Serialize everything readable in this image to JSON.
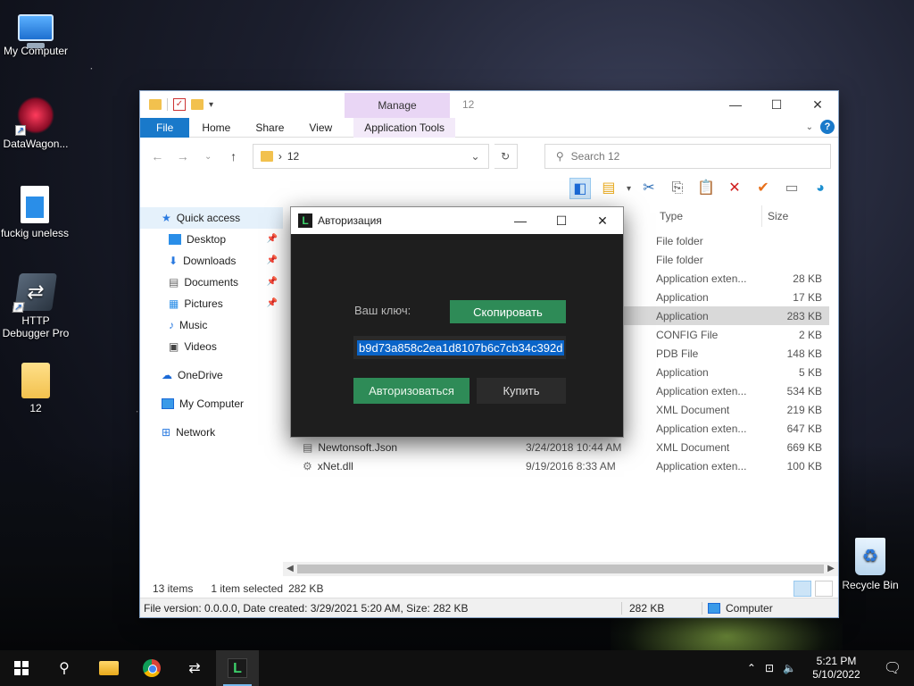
{
  "desktop": {
    "icons": [
      {
        "label": "My Computer",
        "icon": "computer-icon"
      },
      {
        "label": "DataWagon...",
        "icon": "datawagon-icon"
      },
      {
        "label": "fuckig uneless",
        "icon": "video-file-icon"
      },
      {
        "label": "HTTP Debugger Pro",
        "icon": "http-debugger-icon"
      },
      {
        "label": "12",
        "icon": "folder-icon"
      },
      {
        "label": "Recycle Bin",
        "icon": "recycle-bin-icon"
      }
    ]
  },
  "explorer": {
    "manage_tab": "Manage",
    "title": "12",
    "ribbon_tabs": [
      "File",
      "Home",
      "Share",
      "View",
      "Application Tools"
    ],
    "address_crumb": "12",
    "search_placeholder": "Search 12",
    "columns": {
      "type": "Type",
      "size": "Size"
    },
    "nav": [
      {
        "label": "Quick access",
        "pinned": false,
        "level": 0,
        "selected": true
      },
      {
        "label": "Desktop",
        "pinned": true,
        "level": 1
      },
      {
        "label": "Downloads",
        "pinned": true,
        "level": 1
      },
      {
        "label": "Documents",
        "pinned": true,
        "level": 1
      },
      {
        "label": "Pictures",
        "pinned": true,
        "level": 1
      },
      {
        "label": "Music",
        "pinned": false,
        "level": 1
      },
      {
        "label": "Videos",
        "pinned": false,
        "level": 1
      },
      {
        "label": "OneDrive",
        "pinned": false,
        "level": 0
      },
      {
        "label": "My Computer",
        "pinned": false,
        "level": 0
      },
      {
        "label": "Network",
        "pinned": false,
        "level": 0
      }
    ],
    "files": [
      {
        "name": "",
        "date": "",
        "type": "File folder",
        "size": ""
      },
      {
        "name": "",
        "date": "",
        "type": "File folder",
        "size": ""
      },
      {
        "name": "",
        "date": "",
        "type": "Application exten...",
        "size": "28 KB"
      },
      {
        "name": "",
        "date": "",
        "type": "Application",
        "size": "17 KB"
      },
      {
        "name": "",
        "date": "",
        "type": "Application",
        "size": "283 KB",
        "selected": true
      },
      {
        "name": "",
        "date": "",
        "type": "CONFIG File",
        "size": "2 KB"
      },
      {
        "name": "",
        "date": "",
        "type": "PDB File",
        "size": "148 KB"
      },
      {
        "name": "",
        "date": "",
        "type": "Application",
        "size": "5 KB"
      },
      {
        "name": "",
        "date": "",
        "type": "Application exten...",
        "size": "534 KB"
      },
      {
        "name": "",
        "date": "",
        "type": "XML Document",
        "size": "219 KB"
      },
      {
        "name": "",
        "date": "",
        "type": "Application exten...",
        "size": "647 KB"
      },
      {
        "name": "Newtonsoft.Json",
        "date": "3/24/2018 10:44 AM",
        "type": "XML Document",
        "size": "669 KB"
      },
      {
        "name": "xNet.dll",
        "date": "9/19/2016 8:33 AM",
        "type": "Application exten...",
        "size": "100 KB"
      }
    ],
    "status": {
      "items": "13 items",
      "selected": "1 item selected",
      "size": "282 KB"
    },
    "info_bar": {
      "details": "File version: 0.0.0.0, Date created: 3/29/2021 5:20 AM, Size: 282 KB",
      "size": "282 KB",
      "location": "Computer"
    }
  },
  "auth_dialog": {
    "title": "Авторизация",
    "key_label": "Ваш ключ:",
    "copy_button": "Скопировать",
    "key_value": "b9d73a858c2ea1d8107b6c7cb34c392d",
    "authorize_button": "Авторизоваться",
    "buy_button": "Купить"
  },
  "taskbar": {
    "time": "5:21 PM",
    "date": "5/10/2022"
  }
}
